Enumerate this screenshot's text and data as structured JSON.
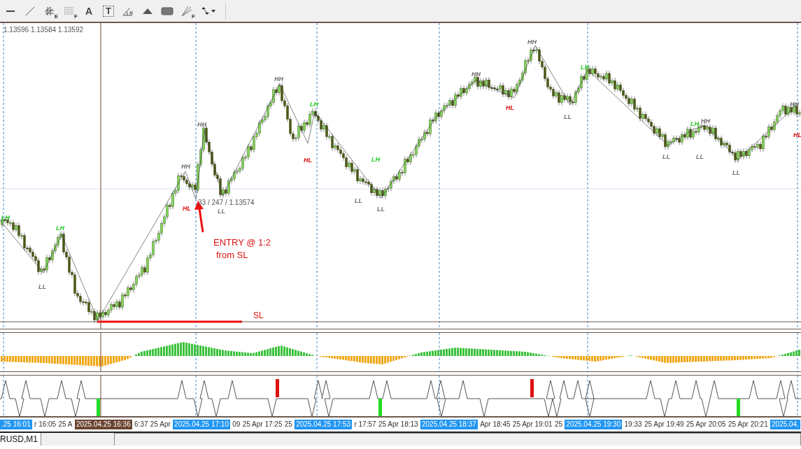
{
  "toolbar": {
    "tools": [
      {
        "kind": "dash"
      },
      {
        "kind": "line"
      },
      {
        "kind": "channel",
        "sub": "E"
      },
      {
        "kind": "grid",
        "sub": "F"
      },
      {
        "kind": "text",
        "label": "A"
      },
      {
        "kind": "label",
        "label": "T"
      },
      {
        "kind": "angle"
      },
      {
        "kind": "triangle"
      },
      {
        "kind": "rectangle"
      },
      {
        "kind": "fan",
        "sub": "F"
      },
      {
        "kind": "arrows"
      }
    ]
  },
  "chart": {
    "ohlc": "1.13596 1.13584 1.13592",
    "swings": [
      {
        "text": "LH",
        "color": "#22cc22"
      },
      {
        "text": "LH",
        "color": "#22cc22"
      },
      {
        "text": "LL",
        "color": "#707070"
      },
      {
        "text": "HH",
        "color": "#707070"
      },
      {
        "text": "HH",
        "color": "#707070"
      },
      {
        "text": "HL",
        "color": "#dd1111"
      },
      {
        "text": "LL",
        "color": "#707070"
      },
      {
        "text": "HH",
        "color": "#707070"
      },
      {
        "text": "LH",
        "color": "#22cc22"
      },
      {
        "text": "HL",
        "color": "#dd1111"
      },
      {
        "text": "LL",
        "color": "#707070"
      },
      {
        "text": "LH",
        "color": "#22cc22"
      },
      {
        "text": "LL",
        "color": "#707070"
      },
      {
        "text": "HH",
        "color": "#707070"
      },
      {
        "text": "HL",
        "color": "#dd1111"
      },
      {
        "text": "HH",
        "color": "#707070"
      },
      {
        "text": "LL",
        "color": "#707070"
      },
      {
        "text": "LH",
        "color": "#22cc22"
      },
      {
        "text": "LL",
        "color": "#707070"
      },
      {
        "text": "LH",
        "color": "#22cc22"
      },
      {
        "text": "HH",
        "color": "#707070"
      },
      {
        "text": "LL",
        "color": "#707070"
      },
      {
        "text": "LL",
        "color": "#707070"
      },
      {
        "text": "HH",
        "color": "#707070"
      },
      {
        "text": "HL",
        "color": "#dd1111"
      }
    ],
    "crosshair_readout": "33 / 247 / 1.13574",
    "entry_note": [
      "ENTRY @ 1:2",
      "from SL"
    ],
    "sl_label": "SL"
  },
  "time_axis": [
    {
      "text": ".25 16:01",
      "kind": "marker"
    },
    {
      "text": "r 16:05",
      "kind": "plain"
    },
    {
      "text": "25 A",
      "kind": "plain"
    },
    {
      "text": "2025.04.25 16:36",
      "kind": "cursor"
    },
    {
      "text": "6:37",
      "kind": "plain"
    },
    {
      "text": "25 Apr",
      "kind": "plain"
    },
    {
      "text": "2025.04.25 17:10",
      "kind": "marker"
    },
    {
      "text": "09",
      "kind": "plain"
    },
    {
      "text": "25 Apr 17:25",
      "kind": "plain"
    },
    {
      "text": "25",
      "kind": "plain"
    },
    {
      "text": "2025.04.25 17:53",
      "kind": "marker"
    },
    {
      "text": "r 17:57",
      "kind": "plain"
    },
    {
      "text": "25 Apr 18:13",
      "kind": "plain"
    },
    {
      "text": "2025.04.25 18:37",
      "kind": "marker"
    },
    {
      "text": "Apr 18:45",
      "kind": "plain"
    },
    {
      "text": "25 Apr 19:01",
      "kind": "plain"
    },
    {
      "text": "25",
      "kind": "plain"
    },
    {
      "text": "2025.04.25 19:30",
      "kind": "marker"
    },
    {
      "text": "19:33",
      "kind": "plain"
    },
    {
      "text": "25 Apr 19:49",
      "kind": "plain"
    },
    {
      "text": "25 Apr 20:05",
      "kind": "plain"
    },
    {
      "text": "25 Apr 20:21",
      "kind": "plain"
    },
    {
      "text": "2025.04.",
      "kind": "marker"
    }
  ],
  "tabs": [
    {
      "label": "RUSD,M1",
      "selected": true
    }
  ]
}
